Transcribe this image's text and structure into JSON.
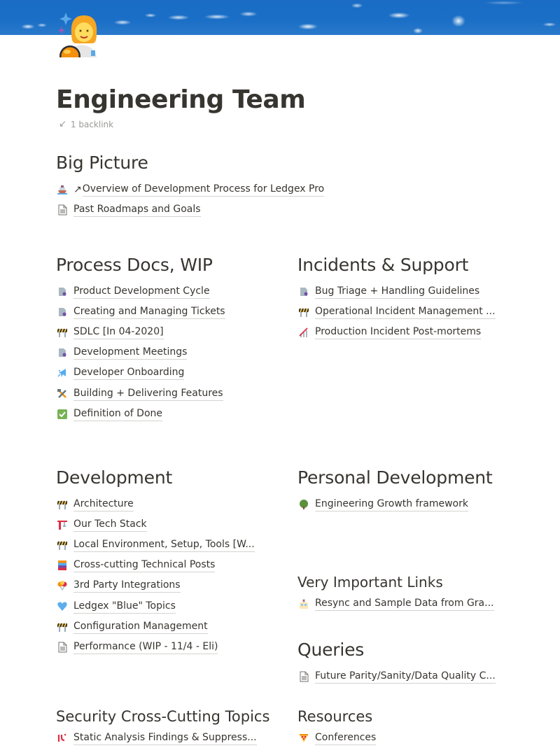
{
  "cover": {
    "description": "blue sky with clouds",
    "color": "#1b6fc6"
  },
  "page": {
    "icon": "woman-astronaut-icon",
    "title": "Engineering Team",
    "backlinks": "1 backlink"
  },
  "sections": {
    "big_picture": {
      "heading": "Big Picture",
      "items": [
        {
          "icon": "ship-icon",
          "label": "Overview of Development Process for Ledgex Pro",
          "external": true
        },
        {
          "icon": "page-icon",
          "label": "Past Roadmaps and Goals"
        }
      ]
    },
    "process_docs": {
      "heading": "Process Docs, WIP",
      "items": [
        {
          "icon": "bookmark-page-icon",
          "label": "Product Development Cycle"
        },
        {
          "icon": "bookmark-page-icon",
          "label": "Creating and Managing Tickets"
        },
        {
          "icon": "construction-icon",
          "label": "SDLC [In 04-2020]"
        },
        {
          "icon": "bookmark-page-icon",
          "label": "Development Meetings"
        },
        {
          "icon": "airplane-icon",
          "label": "Developer Onboarding"
        },
        {
          "icon": "hammer-wrench-icon",
          "label": "Building + Delivering Features"
        },
        {
          "icon": "check-box-icon",
          "label": "Definition of Done"
        }
      ]
    },
    "incidents": {
      "heading": "Incidents & Support",
      "items": [
        {
          "icon": "bookmark-page-icon",
          "label": "Bug Triage + Handling Guidelines"
        },
        {
          "icon": "construction-icon",
          "label": "Operational Incident Management ..."
        },
        {
          "icon": "chart-increasing-icon",
          "label": "Production Incident Post-mortems"
        }
      ]
    },
    "development": {
      "heading": "Development",
      "items": [
        {
          "icon": "construction-icon",
          "label": "Architecture"
        },
        {
          "icon": "crane-icon",
          "label": "Our Tech Stack"
        },
        {
          "icon": "construction-icon",
          "label": "Local Environment, Setup, Tools [W..."
        },
        {
          "icon": "books-icon",
          "label": "Cross-cutting Technical Posts"
        },
        {
          "icon": "balloons-icon",
          "label": "3rd Party Integrations"
        },
        {
          "icon": "blue-heart-icon",
          "label": "Ledgex \"Blue\" Topics"
        },
        {
          "icon": "construction-icon",
          "label": "Configuration Management"
        },
        {
          "icon": "page-icon",
          "label": "Performance (WIP - 11/4 - Eli)"
        }
      ]
    },
    "personal_development": {
      "heading": "Personal Development",
      "items": [
        {
          "icon": "tree-icon",
          "label": "Engineering Growth framework"
        }
      ]
    },
    "very_important_links": {
      "heading": "Very Important Links",
      "items": [
        {
          "icon": "building-icon",
          "label": "Resync and Sample Data from Gra..."
        }
      ]
    },
    "queries": {
      "heading": "Queries",
      "items": [
        {
          "icon": "page-icon",
          "label": "Future Parity/Sanity/Data Quality C..."
        }
      ]
    },
    "security": {
      "heading": "Security Cross-Cutting Topics",
      "items": [
        {
          "icon": "security-alert-icon",
          "label": "Static Analysis Findings & Suppress..."
        }
      ]
    },
    "resources": {
      "heading": "Resources",
      "items": [
        {
          "icon": "pizza-icon",
          "label": "Conferences"
        }
      ]
    }
  }
}
